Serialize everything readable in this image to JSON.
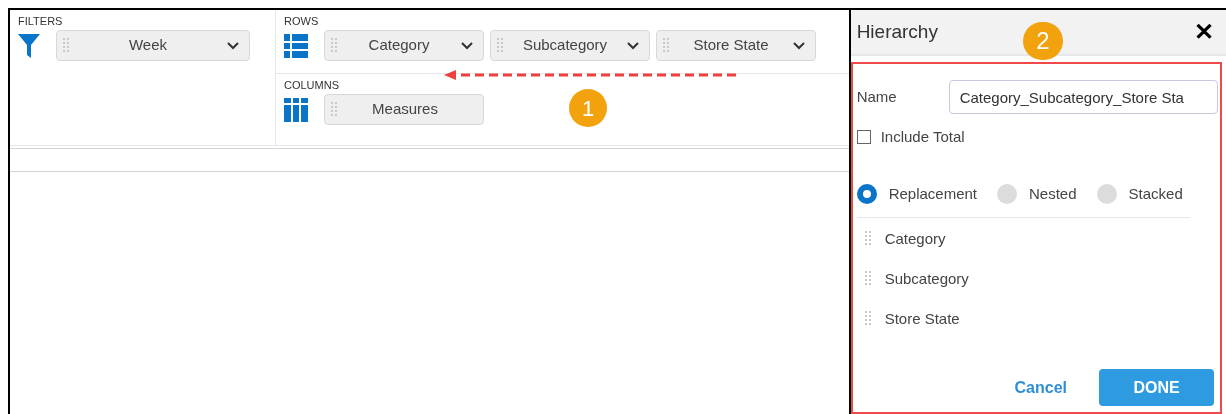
{
  "filters": {
    "label": "FILTERS",
    "chips": [
      {
        "label": "Week",
        "has_dropdown": true
      }
    ]
  },
  "rows": {
    "label": "ROWS",
    "chips": [
      {
        "label": "Category",
        "has_dropdown": true
      },
      {
        "label": "Subcategory",
        "has_dropdown": true
      },
      {
        "label": "Store State",
        "has_dropdown": true
      }
    ]
  },
  "columns": {
    "label": "COLUMNS",
    "chips": [
      {
        "label": "Measures",
        "has_dropdown": false
      }
    ]
  },
  "callouts": [
    "1",
    "2"
  ],
  "hierarchy_panel": {
    "title": "Hierarchy",
    "close": "✕",
    "name_label": "Name",
    "name_value": "Category_Subcategory_Store Sta",
    "include_total": {
      "label": "Include Total",
      "checked": false
    },
    "modes": [
      {
        "label": "Replacement",
        "selected": true
      },
      {
        "label": "Nested",
        "selected": false
      },
      {
        "label": "Stacked",
        "selected": false
      }
    ],
    "levels": [
      "Category",
      "Subcategory",
      "Store State"
    ],
    "buttons": {
      "cancel": "Cancel",
      "done": "DONE"
    }
  }
}
